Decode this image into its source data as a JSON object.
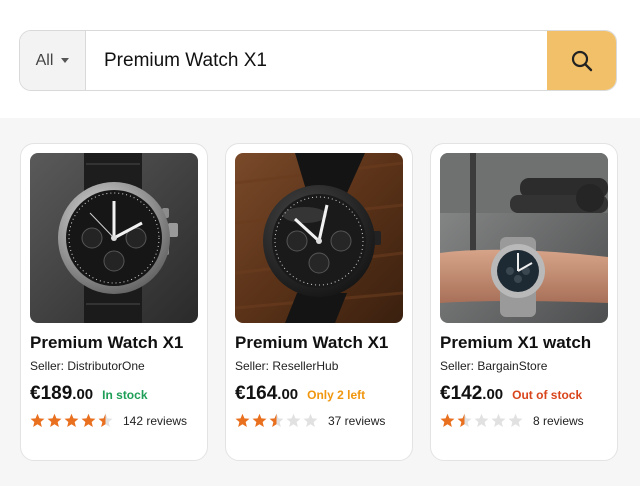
{
  "search": {
    "scope_label": "All",
    "query": "Premium Watch X1"
  },
  "colors": {
    "search_button": "#f2c069",
    "star_filled": "#e8701f",
    "star_empty": "#e1e1e1",
    "in_stock": "#1e9e57",
    "low_stock": "#f0960f",
    "out_of_stock": "#d9451c"
  },
  "products": [
    {
      "title": "Premium Watch X1",
      "seller": "Seller: DistributorOne",
      "price": {
        "currency": "€",
        "whole": "189",
        "cents": ".00"
      },
      "stock": "In stock",
      "rating": 4.5,
      "reviews": "142 reviews",
      "image": "chronograph watch on grey background"
    },
    {
      "title": "Premium Watch X1",
      "seller": "Seller: ResellerHub",
      "price": {
        "currency": "€",
        "whole": "164",
        "cents": ".00"
      },
      "stock": "Only 2 left",
      "rating": 2.5,
      "reviews": "37 reviews",
      "image": "black chronograph watch on wooden surface"
    },
    {
      "title": "Premium X1 watch",
      "seller": "Seller: BargainStore",
      "price": {
        "currency": "€",
        "whole": "142",
        "cents": ".00"
      },
      "stock": "Out of stock",
      "rating": 1.5,
      "reviews": "8 reviews",
      "image": "watch worn on wrist in gym"
    }
  ]
}
